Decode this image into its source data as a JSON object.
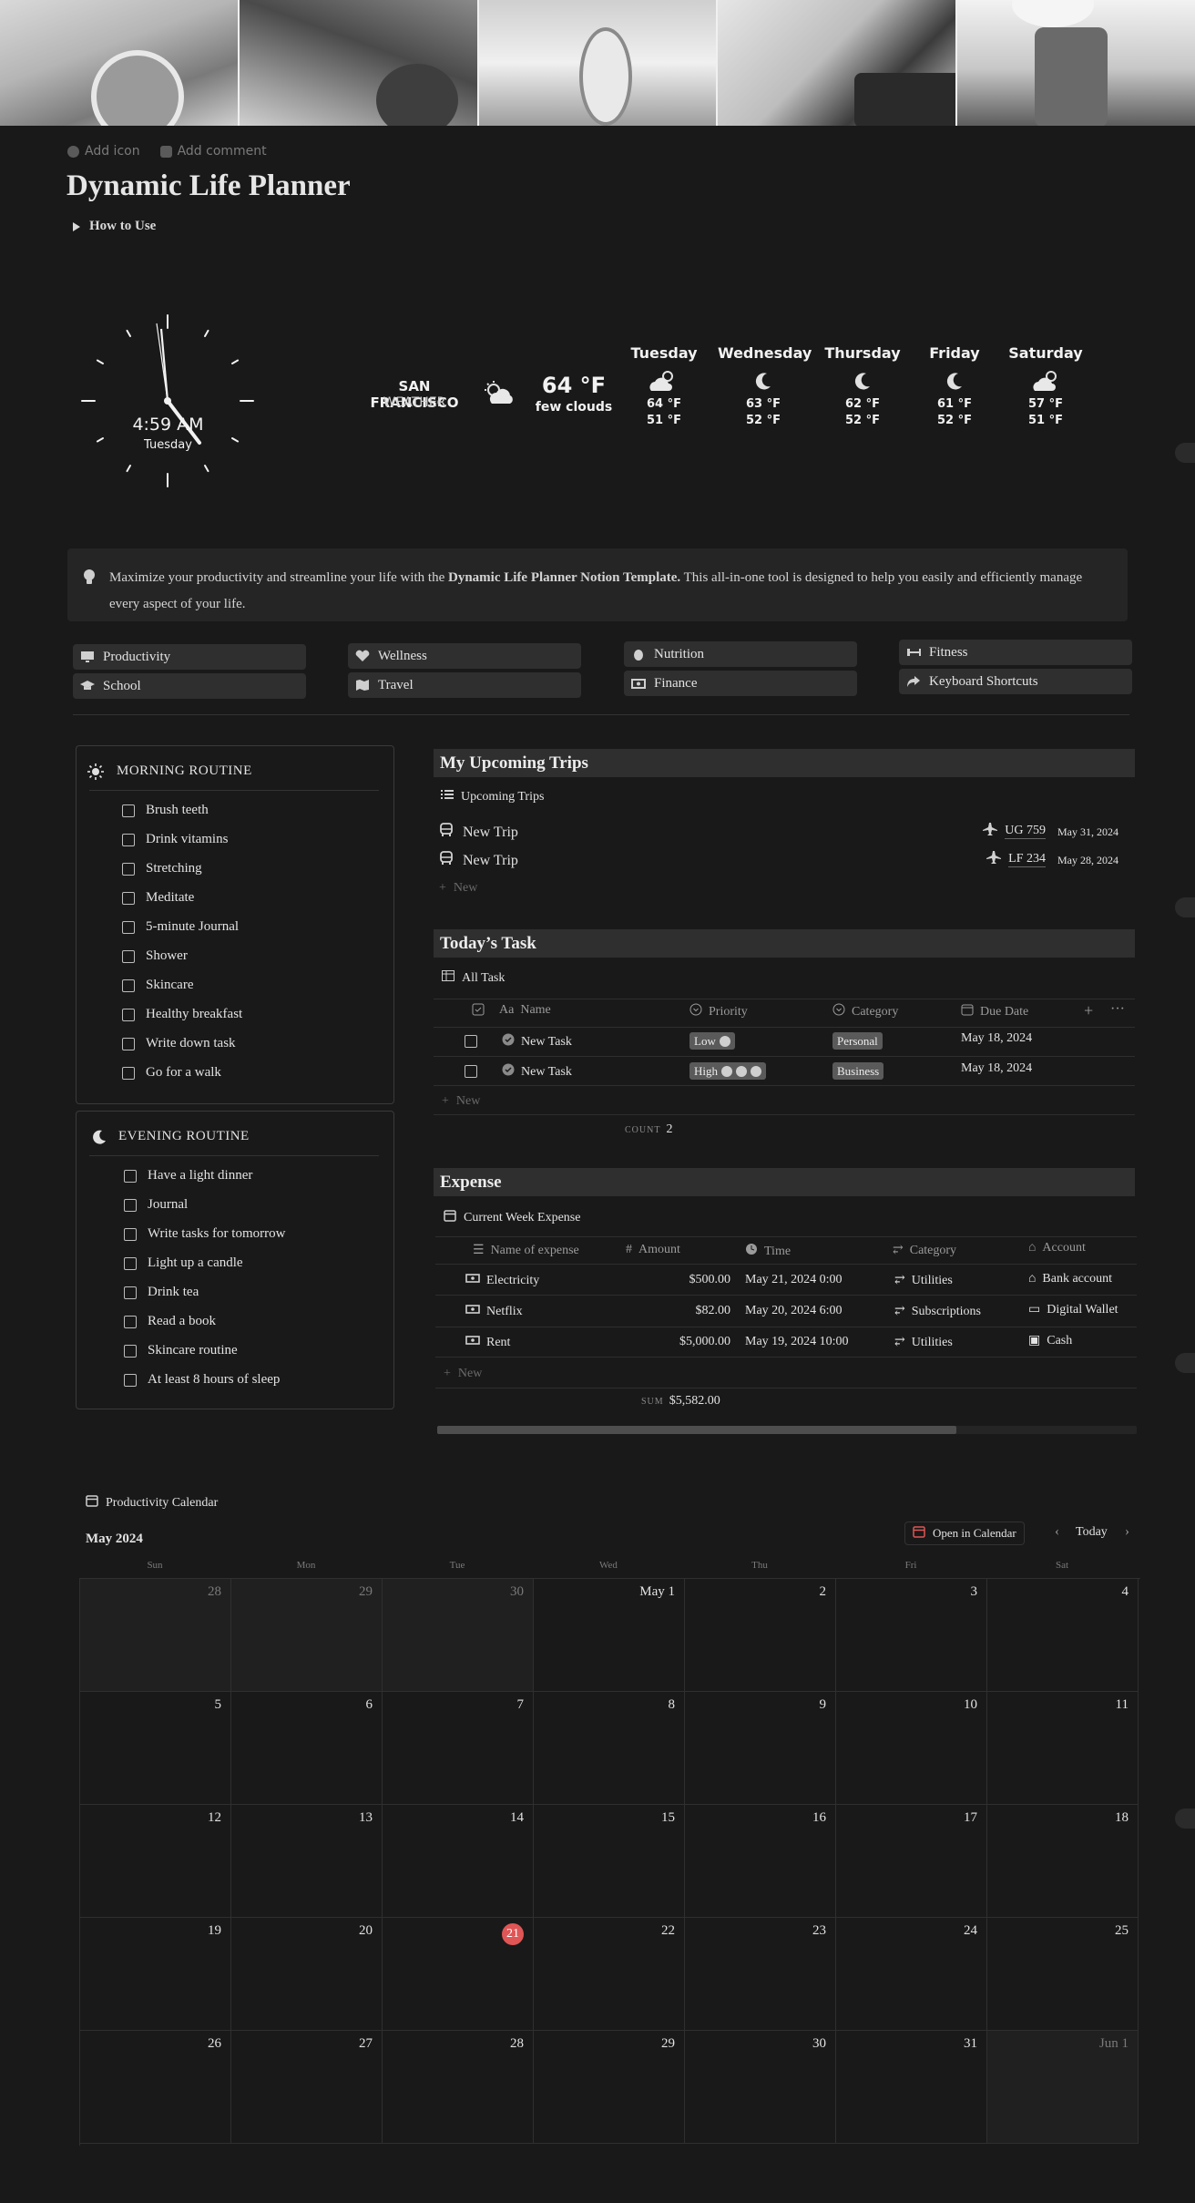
{
  "header": {
    "add_icon": "Add icon",
    "add_comment": "Add comment",
    "title": "Dynamic Life Planner",
    "toggle": "How to Use"
  },
  "clock": {
    "time": "4:59 AM",
    "day": "Tuesday"
  },
  "weather": {
    "city": "SAN FRANCISCO",
    "label": "WEATHER",
    "temp": "64 °F",
    "desc": "few clouds",
    "forecast": [
      {
        "day": "Tuesday",
        "icon": "cloud-sun-icon",
        "high": "64 °F",
        "low": "51 °F"
      },
      {
        "day": "Wednesday",
        "icon": "moon-icon",
        "high": "63 °F",
        "low": "52 °F"
      },
      {
        "day": "Thursday",
        "icon": "moon-icon",
        "high": "62 °F",
        "low": "52 °F"
      },
      {
        "day": "Friday",
        "icon": "moon-icon",
        "high": "61 °F",
        "low": "52 °F"
      },
      {
        "day": "Saturday",
        "icon": "cloud-sun-icon",
        "high": "57 °F",
        "low": "51 °F"
      }
    ]
  },
  "callout": {
    "pre": "Maximize your productivity and streamline your life with the ",
    "bold": "Dynamic Life Planner Notion Template.",
    "post": " This all-in-one tool is designed to help you easily and efficiently manage every aspect of your life."
  },
  "nav": [
    {
      "label": "Productivity",
      "icon": "monitor-icon"
    },
    {
      "label": "School",
      "icon": "graduation-cap-icon"
    },
    {
      "label": "Wellness",
      "icon": "heart-pulse-icon"
    },
    {
      "label": "Travel",
      "icon": "map-icon"
    },
    {
      "label": "Nutrition",
      "icon": "egg-icon"
    },
    {
      "label": "Finance",
      "icon": "money-icon"
    },
    {
      "label": "Fitness",
      "icon": "dumbbell-icon"
    },
    {
      "label": "Keyboard Shortcuts",
      "icon": "share-arrow-icon"
    }
  ],
  "morning": {
    "title": "MORNING ROUTINE",
    "items": [
      "Brush teeth",
      "Drink vitamins",
      "Stretching",
      "Meditate",
      "5-minute Journal",
      "Shower",
      "Skincare",
      "Healthy breakfast",
      "Write down task",
      "Go for a walk"
    ]
  },
  "evening": {
    "title": "EVENING ROUTINE",
    "items": [
      "Have a light dinner",
      "Journal",
      "Write tasks for tomorrow",
      "Light up a candle",
      "Drink tea",
      "Read a book",
      "Skincare routine",
      "At least 8 hours of sleep"
    ]
  },
  "trips": {
    "title": "My Upcoming Trips",
    "view": "Upcoming Trips",
    "rows": [
      {
        "name": "New Trip",
        "flight": "UG 759",
        "date": "May 31, 2024"
      },
      {
        "name": "New Trip",
        "flight": "LF 234",
        "date": "May 28, 2024"
      }
    ],
    "new": "New"
  },
  "tasks": {
    "title": "Today’s Task",
    "view": "All Task",
    "columns": [
      "Name",
      "Priority",
      "Category",
      "Due Date"
    ],
    "rows": [
      {
        "name": "New Task",
        "priority": "Low",
        "category": "Personal",
        "due": "May 18, 2024"
      },
      {
        "name": "New Task",
        "priority": "High",
        "category": "Business",
        "due": "May 18, 2024"
      }
    ],
    "new": "New",
    "count_label": "COUNT",
    "count": "2"
  },
  "expense": {
    "title": "Expense",
    "view": "Current Week Expense",
    "columns": [
      "Name of expense",
      "Amount",
      "Time",
      "Category",
      "Account"
    ],
    "rows": [
      {
        "name": "Electricity",
        "amount": "$500.00",
        "time": "May 21, 2024 0:00",
        "category": "Utilities",
        "account": "Bank account"
      },
      {
        "name": "Netflix",
        "amount": "$82.00",
        "time": "May 20, 2024 6:00",
        "category": "Subscriptions",
        "account": "Digital Wallet"
      },
      {
        "name": "Rent",
        "amount": "$5,000.00",
        "time": "May 19, 2024 10:00",
        "category": "Utilities",
        "account": "Cash"
      }
    ],
    "new": "New",
    "sum_label": "SUM",
    "sum": "$5,582.00"
  },
  "calendar": {
    "view": "Productivity Calendar",
    "month": "May 2024",
    "open_label": "Open in Calendar",
    "today_label": "Today",
    "weekdays": [
      "Sun",
      "Mon",
      "Tue",
      "Wed",
      "Thu",
      "Fri",
      "Sat"
    ],
    "days": [
      "28",
      "29",
      "30",
      "May 1",
      "2",
      "3",
      "4",
      "5",
      "6",
      "7",
      "8",
      "9",
      "10",
      "11",
      "12",
      "13",
      "14",
      "15",
      "16",
      "17",
      "18",
      "19",
      "20",
      "21",
      "22",
      "23",
      "24",
      "25",
      "26",
      "27",
      "28",
      "29",
      "30",
      "31",
      "Jun 1"
    ],
    "outside": [
      0,
      1,
      2,
      34
    ],
    "today_index": 23
  },
  "colors": {
    "background": "#191919",
    "accent_red": "#e05555",
    "panel": "#2f2f2f"
  }
}
